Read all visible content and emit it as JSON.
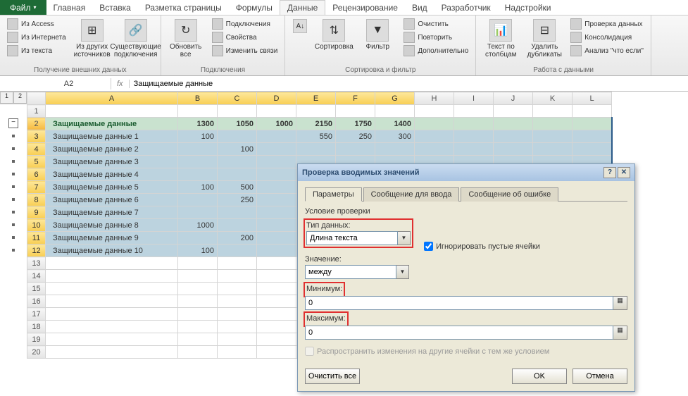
{
  "ribbon_tabs": {
    "file": "Файл",
    "home": "Главная",
    "insert": "Вставка",
    "page_layout": "Разметка страницы",
    "formulas": "Формулы",
    "data": "Данные",
    "review": "Рецензирование",
    "view": "Вид",
    "developer": "Разработчик",
    "addins": "Надстройки"
  },
  "ribbon_groups": {
    "ext_data": {
      "access": "Из Access",
      "web": "Из Интернета",
      "text": "Из текста",
      "other": "Из других источников",
      "existing": "Существующие подключения",
      "title": "Получение внешних данных"
    },
    "connections": {
      "refresh": "Обновить все",
      "connections": "Подключения",
      "properties": "Свойства",
      "edit_links": "Изменить связи",
      "title": "Подключения"
    },
    "sort_filter": {
      "sort": "Сортировка",
      "filter": "Фильтр",
      "clear": "Очистить",
      "reapply": "Повторить",
      "advanced": "Дополнительно",
      "title": "Сортировка и фильтр"
    },
    "data_tools": {
      "text_cols": "Текст по столбцам",
      "remove_dup": "Удалить дубликаты",
      "validation": "Проверка данных",
      "consolidate": "Консолидация",
      "whatif": "Анализ \"что если\"",
      "title": "Работа с данными"
    }
  },
  "name_box": "A2",
  "formula_value": "Защищаемые данные",
  "outline_levels": [
    "1",
    "2"
  ],
  "columns": [
    "A",
    "B",
    "C",
    "D",
    "E",
    "F",
    "G",
    "H",
    "I",
    "J",
    "K",
    "L"
  ],
  "rows": [
    {
      "n": 1,
      "a": "",
      "b": "",
      "c": "",
      "d": "",
      "e": "",
      "f": "",
      "g": ""
    },
    {
      "n": 2,
      "a": "Защищаемые данные",
      "b": "1300",
      "c": "1050",
      "d": "1000",
      "e": "2150",
      "f": "1750",
      "g": "1400",
      "hdr": true
    },
    {
      "n": 3,
      "a": "Защищаемые данные 1",
      "b": "100",
      "c": "",
      "d": "",
      "e": "550",
      "f": "250",
      "g": "300"
    },
    {
      "n": 4,
      "a": "Защищаемые данные 2",
      "b": "",
      "c": "100",
      "d": "",
      "e": "",
      "f": "",
      "g": ""
    },
    {
      "n": 5,
      "a": "Защищаемые данные 3",
      "b": "",
      "c": "",
      "d": "",
      "e": "",
      "f": "",
      "g": ""
    },
    {
      "n": 6,
      "a": "Защищаемые данные 4",
      "b": "",
      "c": "",
      "d": "",
      "e": "",
      "f": "",
      "g": ""
    },
    {
      "n": 7,
      "a": "Защищаемые данные 5",
      "b": "100",
      "c": "500",
      "d": "",
      "e": "",
      "f": "",
      "g": ""
    },
    {
      "n": 8,
      "a": "Защищаемые данные 6",
      "b": "",
      "c": "250",
      "d": "",
      "e": "",
      "f": "",
      "g": ""
    },
    {
      "n": 9,
      "a": "Защищаемые данные 7",
      "b": "",
      "c": "",
      "d": "",
      "e": "",
      "f": "",
      "g": ""
    },
    {
      "n": 10,
      "a": "Защищаемые данные 8",
      "b": "1000",
      "c": "",
      "d": "",
      "e": "",
      "f": "",
      "g": ""
    },
    {
      "n": 11,
      "a": "Защищаемые данные 9",
      "b": "",
      "c": "200",
      "d": "",
      "e": "",
      "f": "",
      "g": ""
    },
    {
      "n": 12,
      "a": "Защищаемые данные 10",
      "b": "100",
      "c": "",
      "d": "",
      "e": "",
      "f": "",
      "g": ""
    }
  ],
  "empty_rows": [
    13,
    14,
    15,
    16,
    17,
    18,
    19,
    20
  ],
  "dialog": {
    "title": "Проверка вводимых значений",
    "tabs": {
      "params": "Параметры",
      "input_msg": "Сообщение для ввода",
      "error_msg": "Сообщение об ошибке"
    },
    "section": "Условие проверки",
    "type_label": "Тип данных:",
    "type_value": "Длина текста",
    "ignore_blank": "Игнорировать пустые ячейки",
    "value_label": "Значение:",
    "value_value": "между",
    "min_label": "Минимум:",
    "min_value": "0",
    "max_label": "Максимум:",
    "max_value": "0",
    "propagate": "Распространить изменения на другие ячейки с тем же условием",
    "clear": "Очистить все",
    "ok": "OK",
    "cancel": "Отмена",
    "help": "?",
    "close": "✕"
  }
}
